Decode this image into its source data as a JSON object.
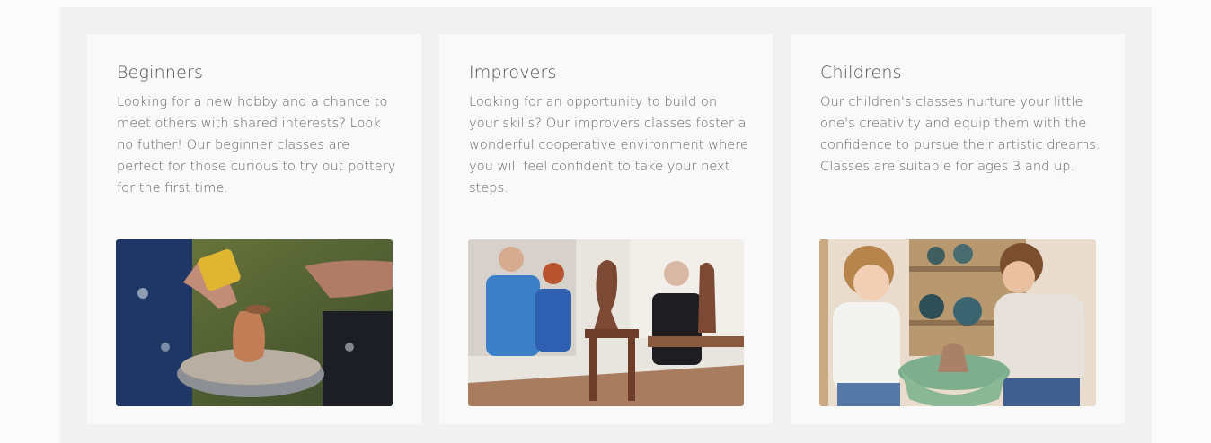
{
  "classes": [
    {
      "title": "Beginners",
      "description": "Looking for a new hobby and a chance to meet others with shared interests? Look no futher! Our beginner classes are perfect for those curious to try out pottery for the first time.",
      "image_subject": "beginner-pottery-wheel-photo"
    },
    {
      "title": "Improvers",
      "description": "Looking for an opportunity to build on your skills? Our improvers classes foster a wonderful cooperative environment where you will feel confident to take your next steps.",
      "image_subject": "improvers-clay-sculpture-photo"
    },
    {
      "title": "Childrens",
      "description": "Our children's classes nurture your little one's creativity and equip them with the confidence to pursue their artistic dreams. Classes are suitable for ages 3 and up.",
      "image_subject": "children-pottery-class-photo"
    }
  ]
}
